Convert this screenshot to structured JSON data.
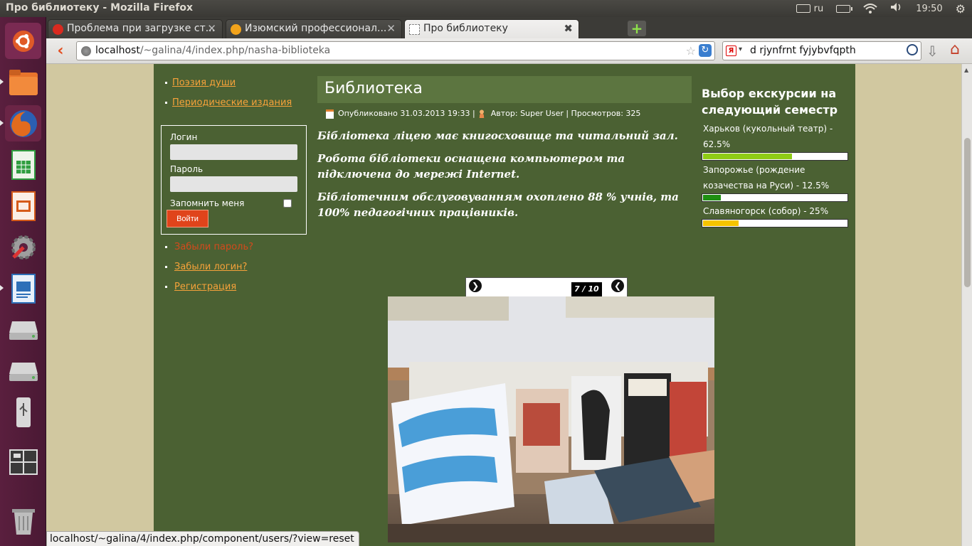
{
  "window": {
    "title": "Про библиотеку - Mozilla Firefox"
  },
  "indicators": {
    "keyboard_layout": "ru",
    "clock": "19:50"
  },
  "launcher": {
    "items": [
      {
        "name": "ubuntu-dash-icon",
        "color": "#e05a28"
      },
      {
        "name": "files-icon",
        "color": "#e8742c"
      },
      {
        "name": "firefox-icon",
        "color": "#e26b1e"
      },
      {
        "name": "calc-spreadsheet-icon",
        "color": "#2f9e40"
      },
      {
        "name": "impress-presentation-icon",
        "color": "#d65b1a"
      },
      {
        "name": "system-settings-icon",
        "color": "#9e9e9e"
      },
      {
        "name": "writer-document-icon",
        "color": "#2d6fb8"
      },
      {
        "name": "drive-1-icon",
        "color": "#b5b5b5"
      },
      {
        "name": "drive-2-icon",
        "color": "#b5b5b5"
      },
      {
        "name": "usb-drive-icon",
        "color": "#c9c9c9"
      },
      {
        "name": "workspaces-icon",
        "color": "#707070"
      },
      {
        "name": "trash-icon",
        "color": "#9c9c9c"
      }
    ]
  },
  "tabs": [
    {
      "label": "Проблема при загрузке ст...",
      "fav_color": "#d92a1f"
    },
    {
      "label": "Изюмский профессионал...",
      "fav_color": "#f2a31b"
    },
    {
      "label": "Про библиотеку",
      "fav_color": "#ffffff"
    }
  ],
  "url": {
    "host": "localhost",
    "path": "/~galina/4/index.php/nasha-biblioteka"
  },
  "search": {
    "engine_glyph": "Я",
    "value": "d rjynfrnt fyjybvfqpth"
  },
  "left": {
    "links_top": [
      "Поэзия души",
      "Периодические издания"
    ],
    "login": {
      "login_label": "Логин",
      "password_label": "Пароль",
      "remember_label": "Запомнить меня",
      "button": "Войти"
    },
    "forgot_password": "Забыли пароль?",
    "forgot_login": "Забыли логин?",
    "register": "Регистрация"
  },
  "article": {
    "title": "Библиотека",
    "meta_published": "Опубликовано 31.03.2013 19:33 |",
    "meta_author": "Автор: Super User | Просмотров: 325",
    "paragraphs": [
      "Бібліотека ліцею має книгосховище та читальний зал.",
      "Робота бібліотеки оснащена компьютером та підключена до мережі Internet.",
      "Бібліотечним обслуговуванням охоплено 88 % учнів, та 100% педагогічних працівників."
    ]
  },
  "gallery": {
    "counter": "7 / 10",
    "next_glyph": "❯",
    "prev_glyph": "❮"
  },
  "poll": {
    "title": "Выбор екскурсии на следующий семестр",
    "options": [
      {
        "label": "Харьков (кукольный театр) - 62.5%",
        "percent": 62.5,
        "color": "#8fcc15"
      },
      {
        "label": "Запорожье (рождение козачества на Руси) - 12.5%",
        "percent": 12.5,
        "color": "#1e8f12"
      },
      {
        "label": "Славяногорск (собор) - 25%",
        "percent": 25,
        "color": "#f5c400"
      }
    ]
  },
  "status": {
    "text": "localhost/~galina/4/index.php/component/users/?view=reset"
  }
}
